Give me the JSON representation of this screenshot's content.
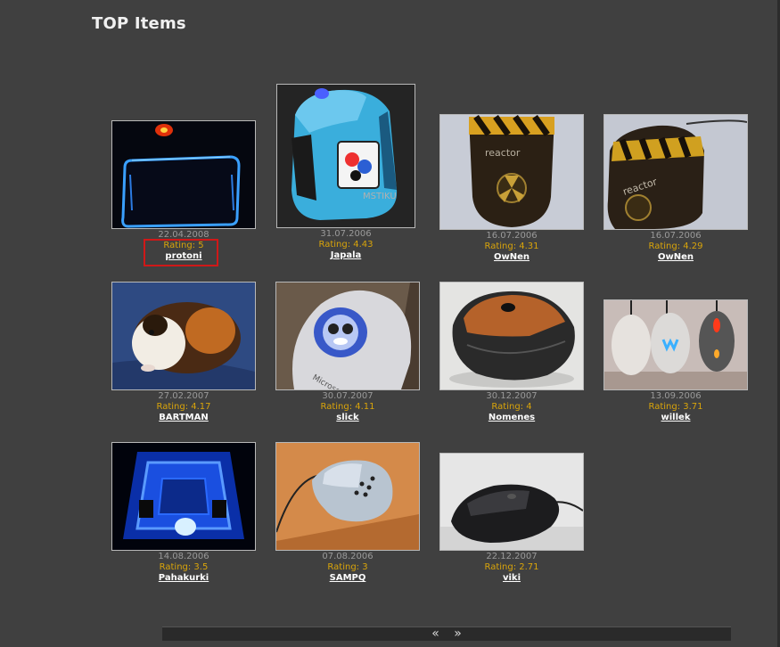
{
  "header": {
    "title": "TOP Items"
  },
  "items": [
    {
      "date": "22.04.2008",
      "rating": "Rating: 5",
      "user": "protoni"
    },
    {
      "date": "31.07.2006",
      "rating": "Rating: 4.43",
      "user": "Japala"
    },
    {
      "date": "16.07.2006",
      "rating": "Rating: 4.31",
      "user": "OwNen"
    },
    {
      "date": "16.07.2006",
      "rating": "Rating: 4.29",
      "user": "OwNen"
    },
    {
      "date": "27.02.2007",
      "rating": "Rating: 4.17",
      "user": "BARTMAN"
    },
    {
      "date": "30.07.2007",
      "rating": "Rating: 4.11",
      "user": "slick"
    },
    {
      "date": "30.12.2007",
      "rating": "Rating: 4",
      "user": "Nomenes"
    },
    {
      "date": "13.09.2006",
      "rating": "Rating: 3.71",
      "user": "willek"
    },
    {
      "date": "14.08.2006",
      "rating": "Rating: 3.5",
      "user": "Pahakurki"
    },
    {
      "date": "07.08.2006",
      "rating": "Rating: 3",
      "user": "SAMPQ"
    },
    {
      "date": "22.12.2007",
      "rating": "Rating: 2.71",
      "user": "viki"
    }
  ],
  "pager": {
    "prev_label": "«",
    "next_label": "»"
  }
}
